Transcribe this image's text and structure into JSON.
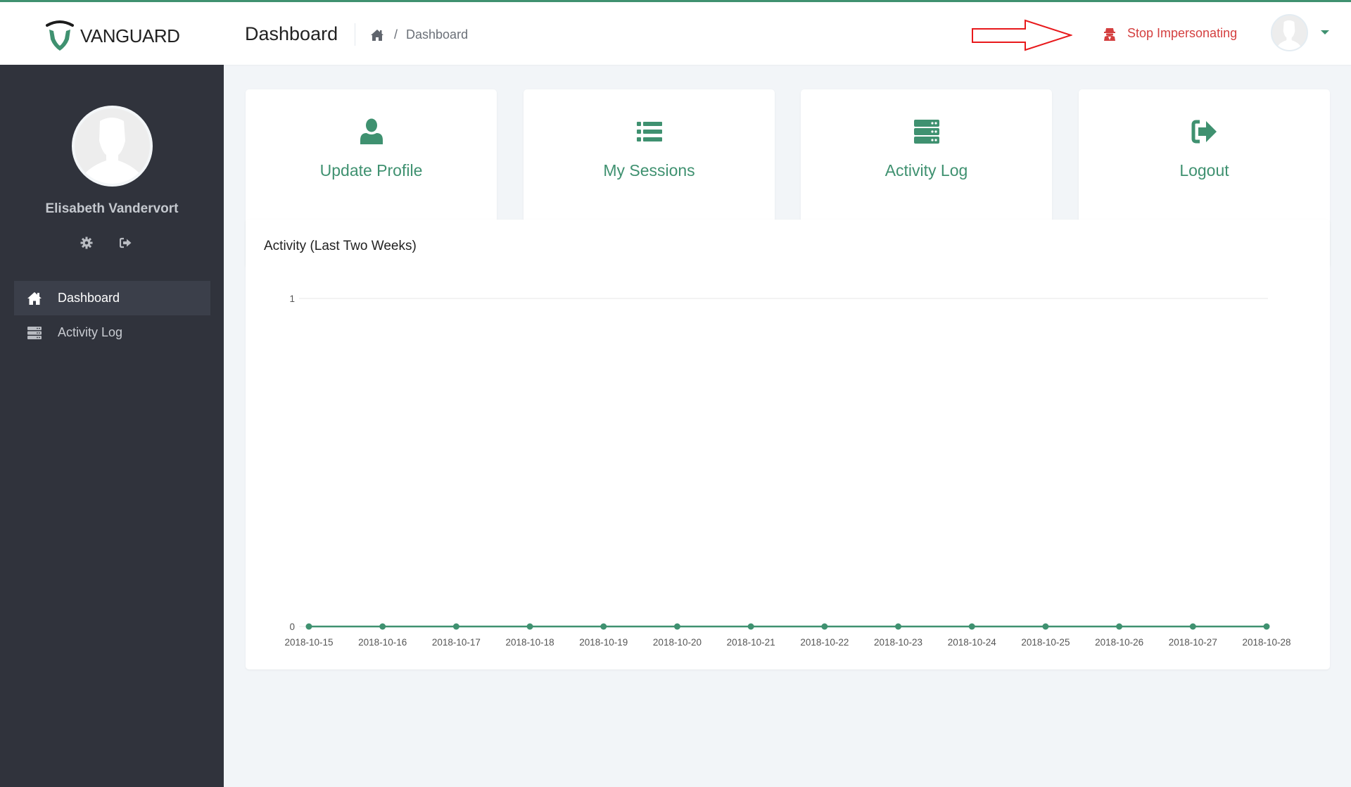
{
  "header": {
    "brand": "VANGUARD",
    "page_title": "Dashboard",
    "breadcrumb": {
      "home_icon": "home-icon",
      "separator": "/",
      "current": "Dashboard"
    },
    "impersonation": {
      "label": "Stop Impersonating",
      "icon": "user-secret-icon",
      "color": "#d43f3f"
    },
    "annotation": "red-outline-arrow",
    "user_menu": {
      "avatar": "default-avatar",
      "caret": "caret-down-icon"
    }
  },
  "sidebar": {
    "user_name": "Elisabeth Vandervort",
    "actions": [
      {
        "icon": "gear-icon",
        "name": "settings"
      },
      {
        "icon": "sign-out-icon",
        "name": "logout"
      }
    ],
    "items": [
      {
        "label": "Dashboard",
        "icon": "home-icon",
        "active": true
      },
      {
        "label": "Activity Log",
        "icon": "server-icon",
        "active": false
      }
    ]
  },
  "cards": [
    {
      "label": "Update Profile",
      "icon": "user-icon"
    },
    {
      "label": "My Sessions",
      "icon": "list-icon"
    },
    {
      "label": "Activity Log",
      "icon": "server-icon"
    },
    {
      "label": "Logout",
      "icon": "sign-out-icon"
    }
  ],
  "colors": {
    "accent": "#3f9170",
    "sidebar_bg": "#30333c",
    "danger": "#d43f3f",
    "page_bg": "#f2f5f8"
  },
  "chart_data": {
    "type": "line",
    "title": "Activity (Last Two Weeks)",
    "xlabel": "",
    "ylabel": "",
    "categories": [
      "2018-10-15",
      "2018-10-16",
      "2018-10-17",
      "2018-10-18",
      "2018-10-19",
      "2018-10-20",
      "2018-10-21",
      "2018-10-22",
      "2018-10-23",
      "2018-10-24",
      "2018-10-25",
      "2018-10-26",
      "2018-10-27",
      "2018-10-28"
    ],
    "series": [
      {
        "name": "Activity",
        "values": [
          0,
          0,
          0,
          0,
          0,
          0,
          0,
          0,
          0,
          0,
          0,
          0,
          0,
          0
        ],
        "color": "#3f9170"
      }
    ],
    "ylim": [
      0,
      1
    ],
    "yticks": [
      0,
      1
    ],
    "grid": true,
    "legend": "none"
  }
}
